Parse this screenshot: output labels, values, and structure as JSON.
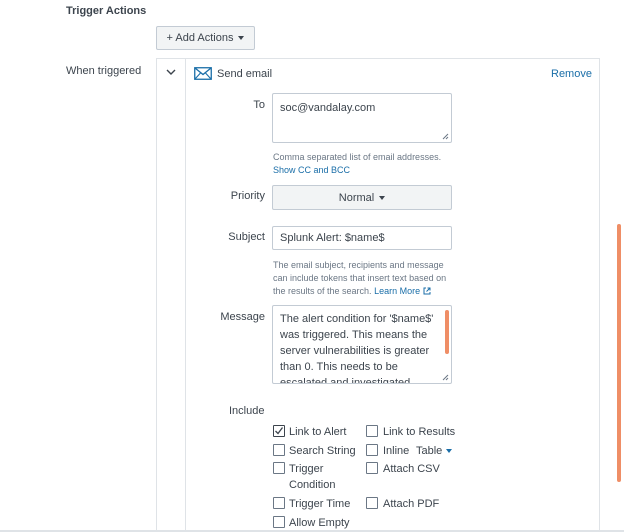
{
  "section": {
    "title": "Trigger Actions",
    "add_actions_label": "+ Add Actions"
  },
  "when_triggered_label": "When triggered",
  "action": {
    "name": "Send email",
    "remove_label": "Remove",
    "to": {
      "label": "To",
      "value": "soc@vandalay.com",
      "help": "Comma separated list of email addresses.",
      "show_cc_bcc": "Show CC and BCC"
    },
    "priority": {
      "label": "Priority",
      "value": "Normal"
    },
    "subject": {
      "label": "Subject",
      "value": "Splunk Alert: $name$",
      "help_1": "The email subject, recipients and message",
      "help_2": "can include tokens that insert text based on",
      "help_3": "the results of the search.",
      "learn_more": "Learn More"
    },
    "message": {
      "label": "Message",
      "line_1": "The alert condition for '$name$'",
      "line_2": "was triggered. This means the",
      "line_3": "server vulnerabilities is greater",
      "line_4": "than 0. This needs to be",
      "line_5": "escalated and investigated"
    },
    "include": {
      "label": "Include",
      "link_to_alert": "Link to Alert",
      "link_to_results": "Link to Results",
      "search_string": "Search String",
      "inline": "Inline",
      "inline_format": "Table",
      "trigger_condition_1": "Trigger",
      "trigger_condition_2": "Condition",
      "attach_csv": "Attach CSV",
      "trigger_time": "Trigger Time",
      "attach_pdf": "Attach PDF",
      "allow_empty": "Allow Empty"
    }
  },
  "colors": {
    "link": "#1a6ea8",
    "scrollbar": "#ef8e66",
    "border": "#c3cbd4"
  }
}
